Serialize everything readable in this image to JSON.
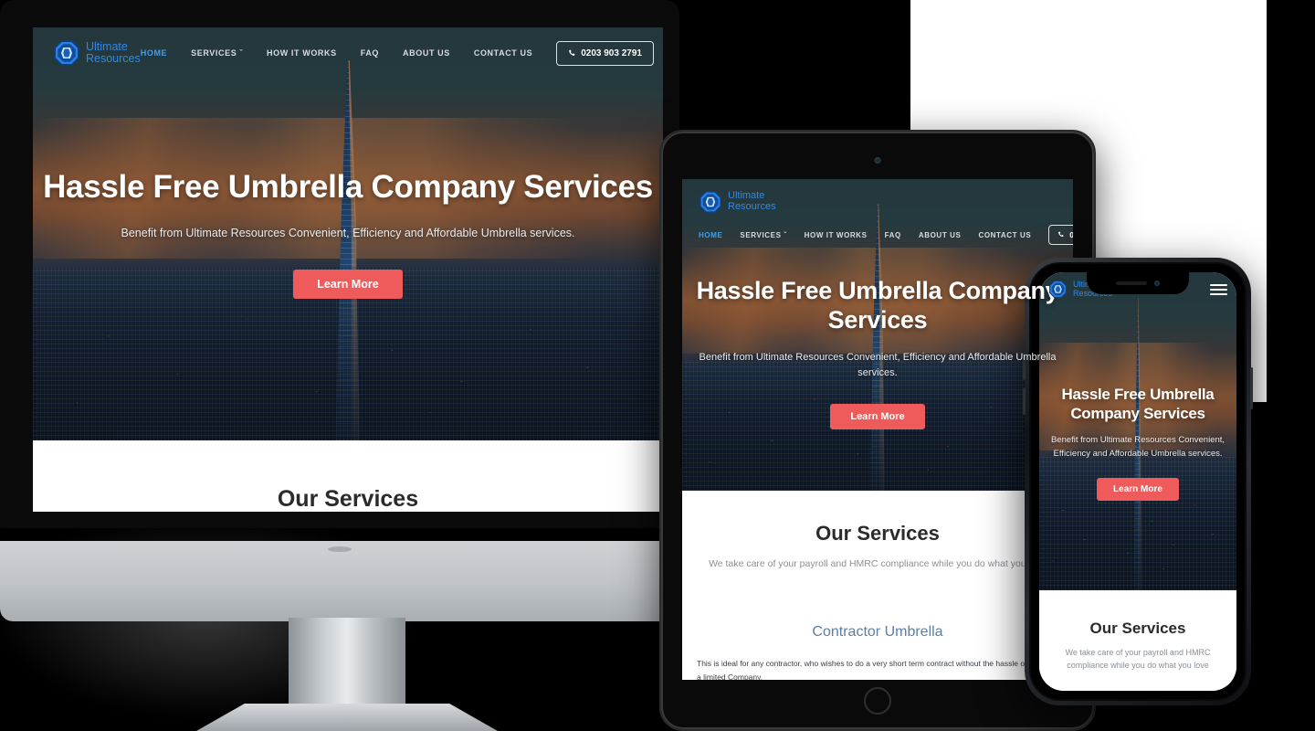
{
  "brand": {
    "name_line1": "Ultimate",
    "name_line2": "Resources",
    "logo_icon": "octagon-gem-icon",
    "accent_color": "#2f89e8",
    "cta_color": "#ef5b5b",
    "active_nav_color": "#3fa0ef"
  },
  "nav": {
    "items": [
      {
        "label": "HOME",
        "active": true
      },
      {
        "label": "SERVICES",
        "has_dropdown": true,
        "caret": "ˇ"
      },
      {
        "label": "HOW IT WORKS",
        "active": false
      },
      {
        "label": "FAQ",
        "active": false
      },
      {
        "label": "ABOUT US",
        "active": false
      },
      {
        "label": "CONTACT US",
        "active": false
      }
    ],
    "phone_label": "0203 903 2791",
    "phone_icon": "phone-handset-icon",
    "menu_icon": "hamburger-menu-icon"
  },
  "hero": {
    "title": "Hassle Free Umbrella Company Services",
    "subtitle": "Benefit from Ultimate Resources Convenient, Efficiency and Affordable Umbrella services.",
    "cta_label": "Learn More",
    "background_image": "london-shard-sunset-skyline"
  },
  "services": {
    "title": "Our Services",
    "subtitle": "We take care of your payroll and HMRC compliance while you do what you love",
    "items": [
      {
        "name": "Contractor Umbrella",
        "body": "This is ideal for any contractor, who wishes to do a very short term contract without the hassle of owning a limited Company."
      }
    ]
  },
  "devices": [
    {
      "type": "desktop",
      "name": "imac-desktop-mockup"
    },
    {
      "type": "tablet",
      "name": "ipad-tablet-mockup"
    },
    {
      "type": "phone",
      "name": "iphone-mobile-mockup"
    }
  ]
}
